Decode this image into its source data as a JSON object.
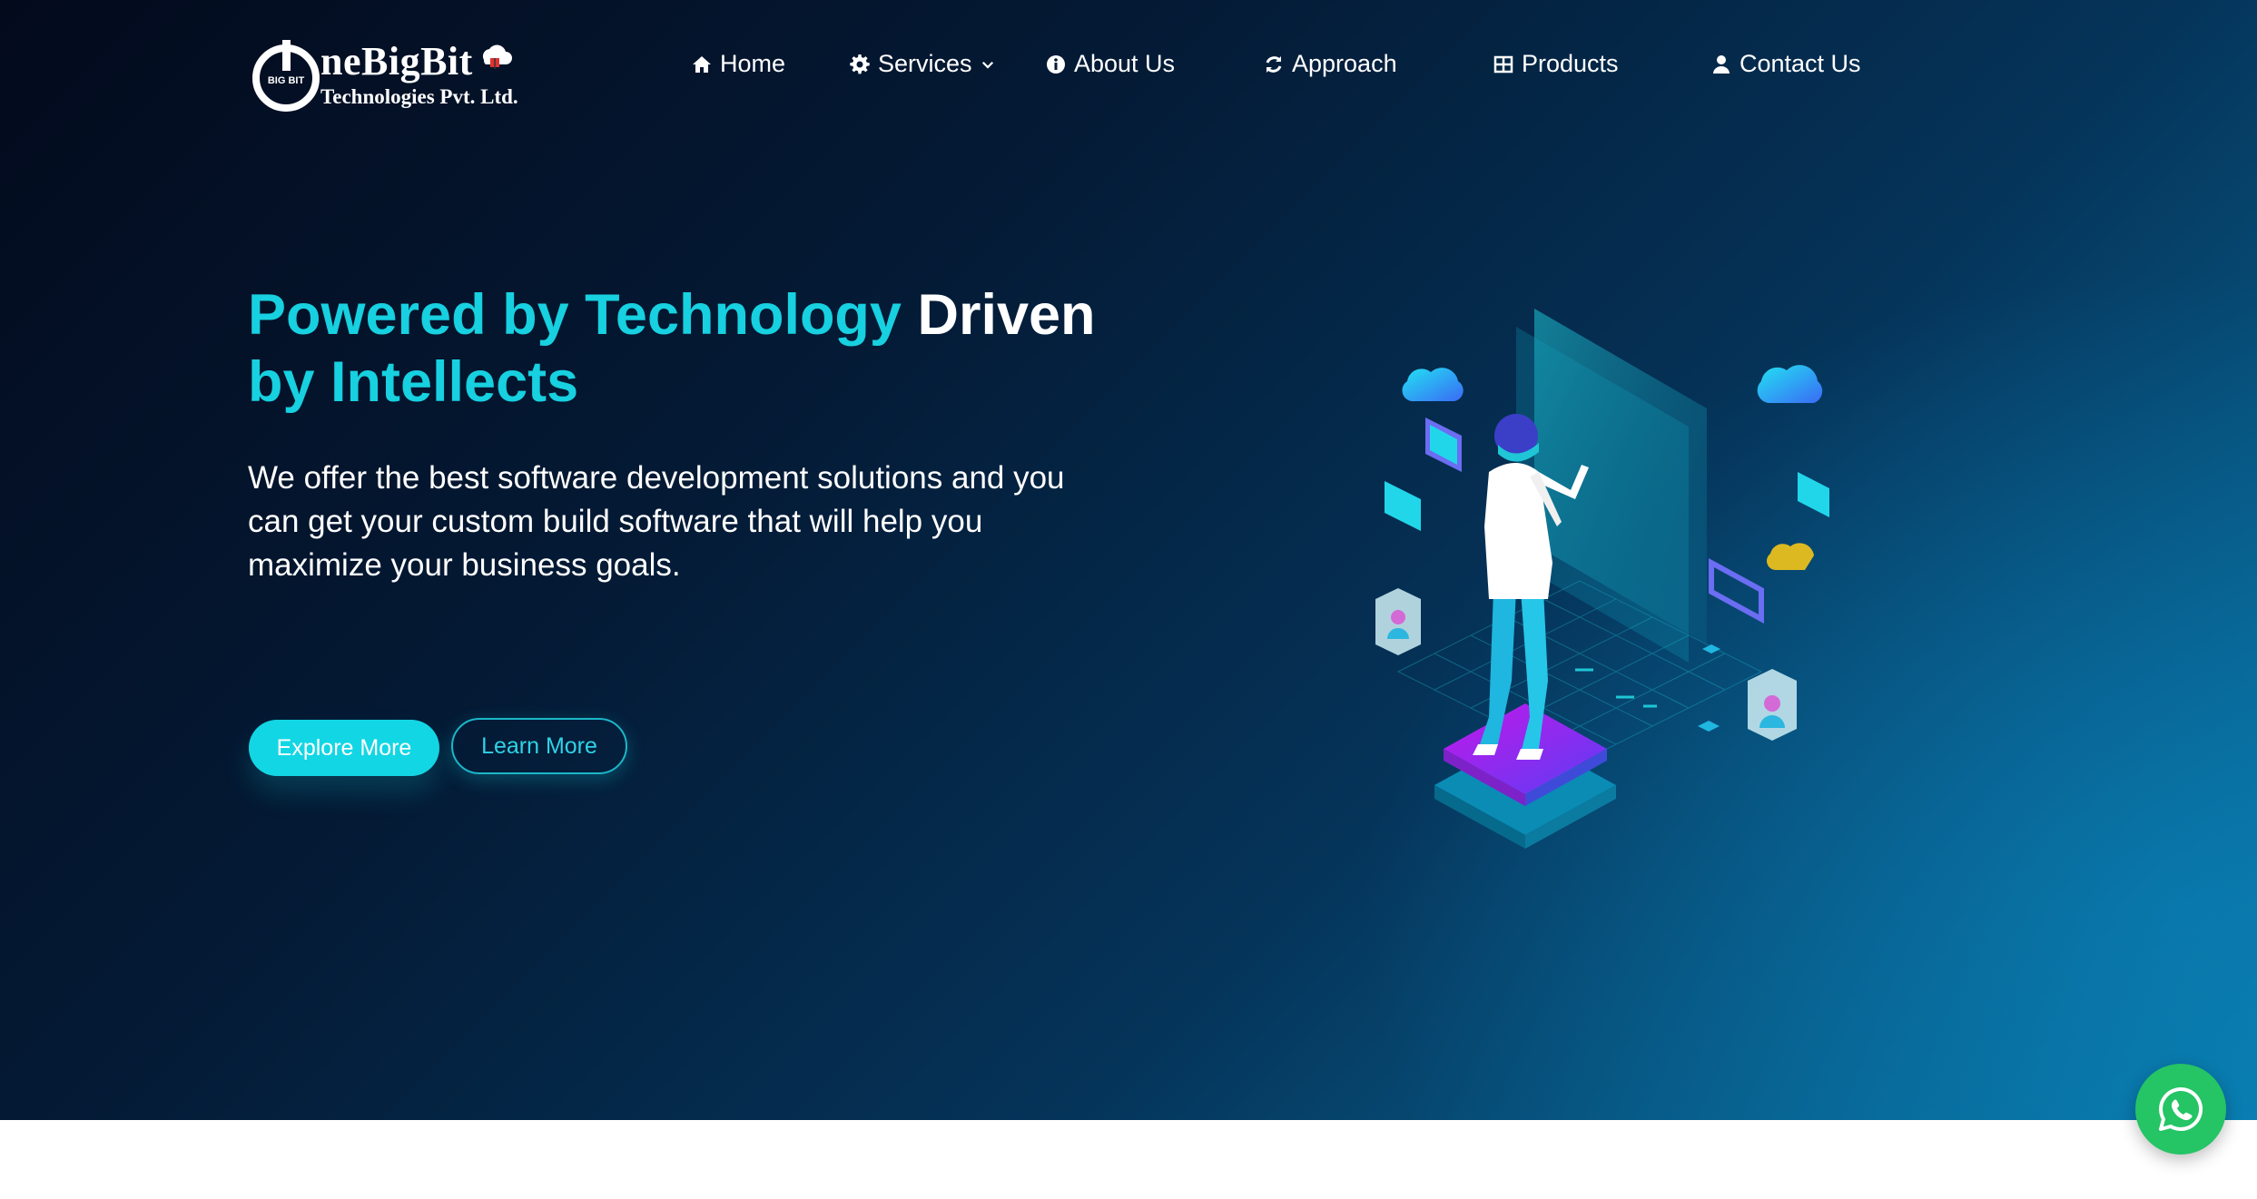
{
  "brand": {
    "name": "neBigBit",
    "subtitle": "Technologies Pvt. Ltd.",
    "mark_text": "BIG BIT",
    "logo_icon": "power-button-icon"
  },
  "nav": [
    {
      "label": "Home",
      "icon": "home-icon"
    },
    {
      "label": "Services",
      "icon": "gear-icon",
      "has_dropdown": true
    },
    {
      "label": "About Us",
      "icon": "info-icon"
    },
    {
      "label": "Approach",
      "icon": "refresh-icon"
    },
    {
      "label": "Products",
      "icon": "grid-icon"
    },
    {
      "label": "Contact Us",
      "icon": "user-icon"
    }
  ],
  "hero": {
    "headline_accent_1": "Powered by Technology",
    "headline_plain": "Driven",
    "headline_accent_2": "by Intellects",
    "lead": "We offer the best software development solutions and you can get your custom build software that will help you maximize your business goals.",
    "primary_button": "Explore More",
    "secondary_button": "Learn More"
  },
  "floating": {
    "icon": "whatsapp-icon"
  },
  "colors": {
    "accent": "#17d0e0",
    "bg_dark": "#030a1c",
    "bg_light": "#0878a8",
    "whatsapp": "#25c465"
  }
}
